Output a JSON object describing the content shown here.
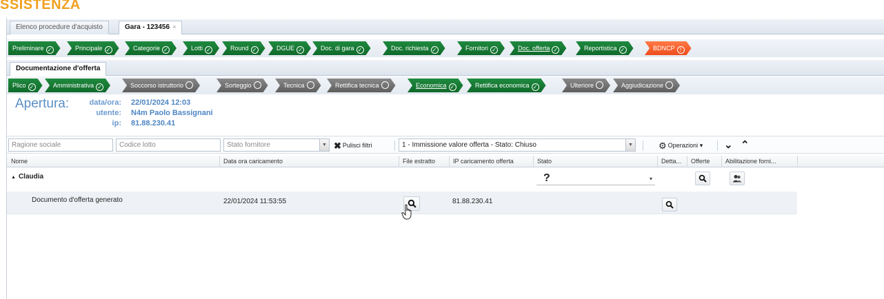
{
  "brand": "SSISTENZA",
  "tabs": [
    {
      "label": "Elenco procedure d'acquisto",
      "active": false
    },
    {
      "label": "Gara - 123456",
      "active": true,
      "close": "×"
    }
  ],
  "main_steps": [
    {
      "label": "Preliminare",
      "status": "green"
    },
    {
      "label": "Principale",
      "status": "green"
    },
    {
      "label": "Categorie",
      "status": "green"
    },
    {
      "label": "Lotti",
      "status": "green"
    },
    {
      "label": "Round",
      "status": "green"
    },
    {
      "label": "DGUE",
      "status": "green"
    },
    {
      "label": "Doc. di gara",
      "status": "green"
    },
    {
      "label": "Doc. richiesta",
      "status": "green"
    },
    {
      "label": "Fornitori",
      "status": "green"
    },
    {
      "label": "Doc. offerta",
      "status": "green",
      "current": true
    },
    {
      "label": "Reportistica",
      "status": "green"
    },
    {
      "label": "BDNCP",
      "status": "red"
    }
  ],
  "subtab_label": "Documentazione d'offerta",
  "sub_steps": [
    {
      "label": "Plico",
      "status": "green"
    },
    {
      "label": "Amministrativa",
      "status": "green"
    },
    {
      "label": "Soccorso istruttorio",
      "status": "gray"
    },
    {
      "label": "Sorteggio",
      "status": "gray"
    },
    {
      "label": "Tecnica",
      "status": "gray"
    },
    {
      "label": "Rettifica tecnica",
      "status": "gray"
    },
    {
      "label": "Economica",
      "status": "green",
      "current": true
    },
    {
      "label": "Rettifica economica",
      "status": "green"
    },
    {
      "label": "Ulteriore",
      "status": "gray"
    },
    {
      "label": "Aggiudicazione",
      "status": "gray"
    }
  ],
  "apertura": {
    "title": "Apertura:",
    "labels": {
      "data": "data/ora:",
      "utente": "utente:",
      "ip": "ip:"
    },
    "values": {
      "data": "22/01/2024 12:03",
      "utente": "N4m Paolo Bassignani",
      "ip": "81.88.230.41"
    }
  },
  "filters": {
    "ragione_sociale_placeholder": "Ragione sociale",
    "codice_lotto_placeholder": "Codice lotto",
    "stato_fornitore_placeholder": "Stato fornitore",
    "clear_label": "Pulisci filtri",
    "round_select_value": "1 - Immissione valore offerta - Stato: Chiuso",
    "operazioni_label": "Operazioni"
  },
  "columns": {
    "nome": "Nome",
    "data_ora": "Data ora caricamento",
    "file_estratto": "File estratto",
    "ip_caricamento": "IP caricamento offerta",
    "stato": "Stato",
    "dettaglio": "Detta...",
    "offerte": "Offerte",
    "abilitazione": "Abilitazione forni..."
  },
  "group": {
    "expander": "▲",
    "name": "Claudia",
    "stato_value": "?"
  },
  "row": {
    "nome": "Documento d'offerta generato",
    "data_ora": "22/01/2024 11:53:55",
    "ip": "81.88.230.41"
  },
  "colors": {
    "green_step": "#1a7e3a",
    "gray_step": "#707070",
    "red_step": "#f4602a",
    "apertura_blue": "#5a8fc4",
    "brand_orange": "#f0a020"
  }
}
